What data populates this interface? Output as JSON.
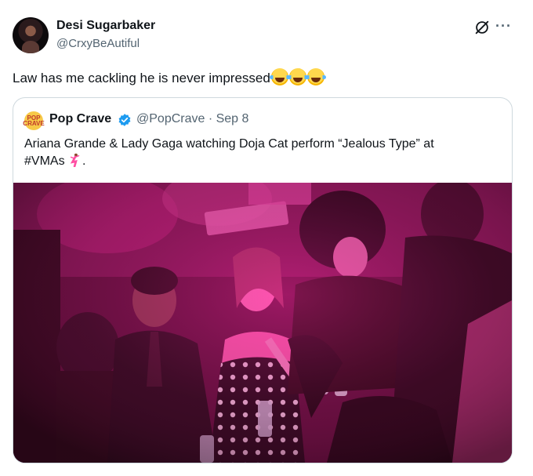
{
  "author": {
    "display_name": "Desi Sugarbaker",
    "handle": "@CrxyBeAutiful"
  },
  "tweet": {
    "text": "Law has me cackling he is never impressed",
    "emoji_count": 3
  },
  "quoted_tweet": {
    "avatar_text": "POP CRAVE",
    "display_name": "Pop Crave",
    "handle_date": "@PopCrave · Sep 8",
    "text_line1": "Ariana Grande & Lady Gaga watching Doja Cat perform “Jealous Type” at",
    "text_line2": "#VMAs",
    "text_suffix": ".",
    "verified_color": "#1d9bf0"
  },
  "colors": {
    "text_primary": "#0f1419",
    "text_secondary": "#536471",
    "border": "#cfd9de",
    "photo_tint": "#e0148a"
  },
  "icons": [
    "grok-icon",
    "more-icon",
    "verified-badge-icon",
    "face-with-tears-of-joy-emoji",
    "dancer-emoji"
  ]
}
